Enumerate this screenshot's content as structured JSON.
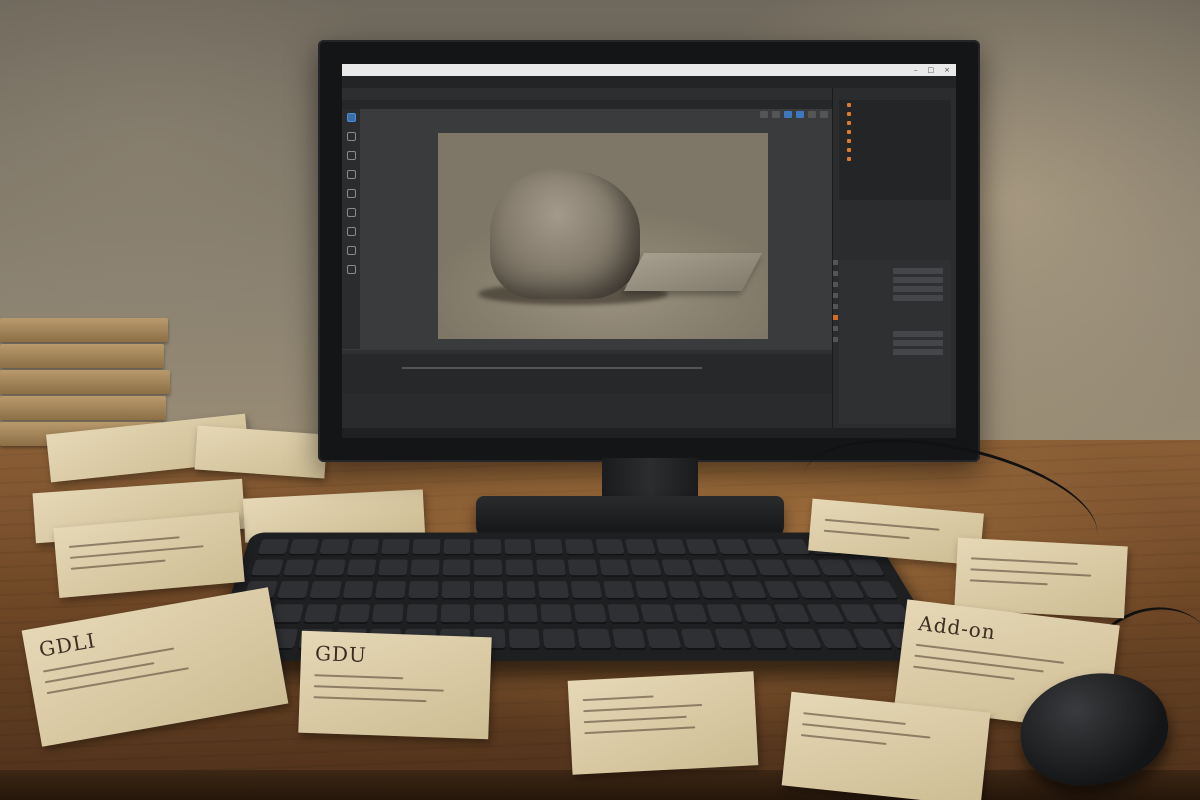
{
  "scene": {
    "app_titlebar": "",
    "menus": [],
    "right_menu": [],
    "toolbar": [],
    "viewport_tabs": [],
    "timeline_tabs": [],
    "status_items": [],
    "outliner_items": [],
    "properties_head": "",
    "property_rows": []
  },
  "notes": {
    "left_title": "GDLI",
    "center_title": "GDU",
    "right_title": "Add-on"
  }
}
